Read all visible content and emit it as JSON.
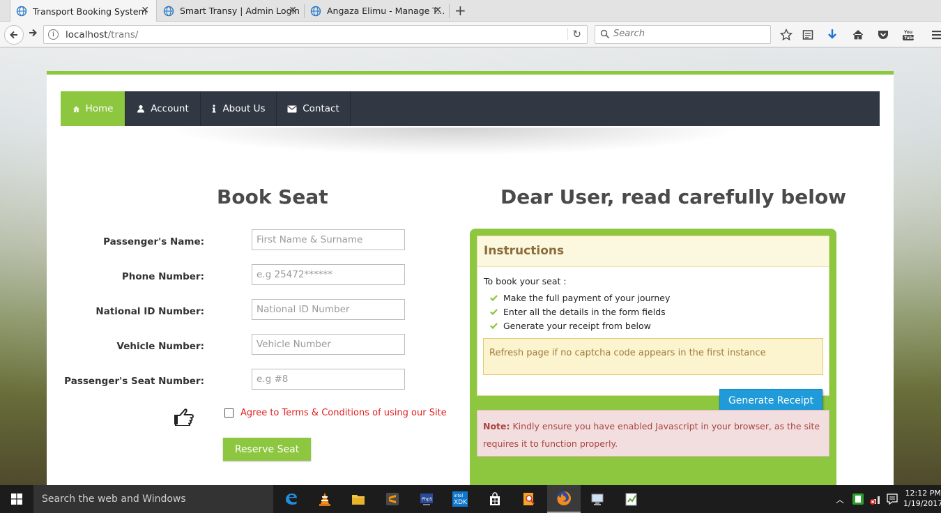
{
  "browser": {
    "tabs": [
      {
        "title": "Transport Booking System",
        "active": true
      },
      {
        "title": "Smart Transy | Admin Login",
        "active": false
      },
      {
        "title": "Angaza Elimu - Manage T...",
        "active": false
      }
    ],
    "url_host": "localhost",
    "url_path": "/trans/",
    "search_placeholder": "Search"
  },
  "site": {
    "menu": [
      {
        "label": "Home",
        "icon": "home-icon",
        "active": true
      },
      {
        "label": "Account",
        "icon": "user-icon",
        "active": false
      },
      {
        "label": "About Us",
        "icon": "info-icon",
        "active": false
      },
      {
        "label": "Contact",
        "icon": "envelope-icon",
        "active": false
      }
    ],
    "accent_color": "#8dc63f",
    "menu_color": "#313843"
  },
  "booking": {
    "heading": "Book Seat",
    "fields": [
      {
        "label": "Passenger's Name:",
        "placeholder": "First Name & Surname"
      },
      {
        "label": "Phone Number:",
        "placeholder": "e.g 25472******"
      },
      {
        "label": "National ID Number:",
        "placeholder": "National ID Number"
      },
      {
        "label": "Vehicle Number:",
        "placeholder": "Vehicle Number"
      },
      {
        "label": "Passenger's Seat Number:",
        "placeholder": "e.g #8"
      }
    ],
    "terms_label": "Agree to Terms & Conditions of using our Site",
    "submit_label": "Reserve Seat"
  },
  "instructions": {
    "heading": "Dear User, read carefully below",
    "panel_title": "Instructions",
    "intro": "To book your seat :",
    "steps": [
      "Make the full payment of your journey",
      "Enter all the details in the form fields",
      "Generate your receipt from below"
    ],
    "captcha_note": "Refresh page if no captcha code appears in the first instance",
    "generate_label": "Generate Receipt",
    "js_note_label": "Note:",
    "js_note_text": " Kindly ensure you have enabled Javascript in your browser, as the site requires it to function properly."
  },
  "taskbar": {
    "search_text": "Search the web and Windows",
    "time": "12:12 PM",
    "date": "1/19/2017"
  }
}
